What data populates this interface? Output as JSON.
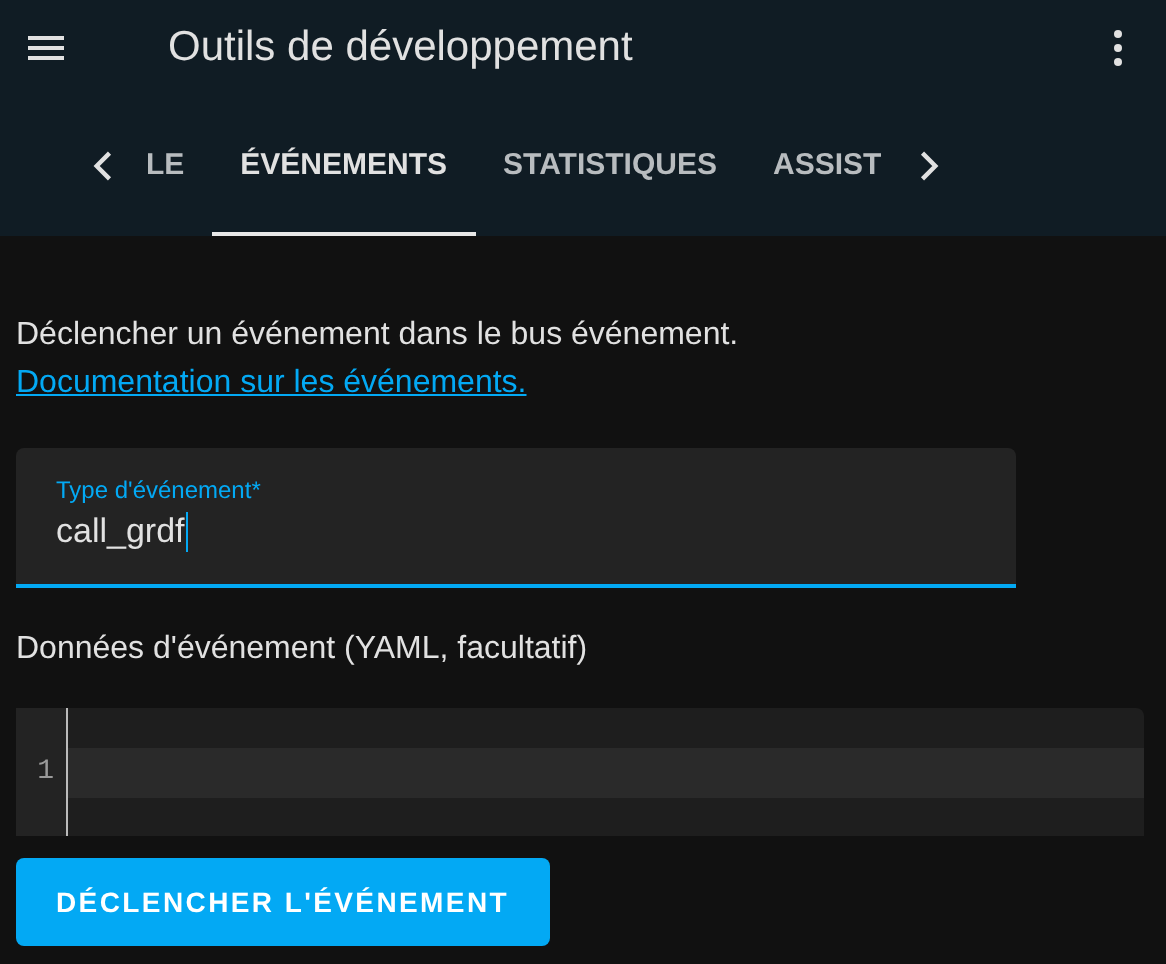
{
  "header": {
    "title": "Outils de développement"
  },
  "tabs": [
    {
      "label": "LE",
      "selected": false
    },
    {
      "label": "ÉVÉNEMENTS",
      "selected": true
    },
    {
      "label": "STATISTIQUES",
      "selected": false
    },
    {
      "label": "ASSIST",
      "selected": false
    }
  ],
  "description": {
    "text": "Déclencher un événement dans le bus événement.",
    "link": "Documentation sur les événements."
  },
  "event_type_field": {
    "label": "Type d'événement*",
    "value": "call_grdf"
  },
  "event_data": {
    "label": "Données d'événement (YAML, facultatif)",
    "line_numbers": [
      "1"
    ]
  },
  "button": "DÉCLENCHER L'ÉVÉNEMENT"
}
